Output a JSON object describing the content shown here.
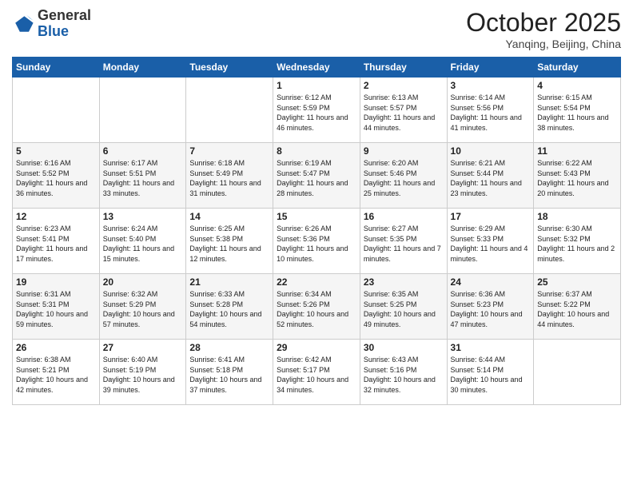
{
  "header": {
    "logo_general": "General",
    "logo_blue": "Blue",
    "month": "October 2025",
    "location": "Yanqing, Beijing, China"
  },
  "days_of_week": [
    "Sunday",
    "Monday",
    "Tuesday",
    "Wednesday",
    "Thursday",
    "Friday",
    "Saturday"
  ],
  "weeks": [
    [
      {
        "day": "",
        "info": ""
      },
      {
        "day": "",
        "info": ""
      },
      {
        "day": "",
        "info": ""
      },
      {
        "day": "1",
        "info": "Sunrise: 6:12 AM\nSunset: 5:59 PM\nDaylight: 11 hours and 46 minutes."
      },
      {
        "day": "2",
        "info": "Sunrise: 6:13 AM\nSunset: 5:57 PM\nDaylight: 11 hours and 44 minutes."
      },
      {
        "day": "3",
        "info": "Sunrise: 6:14 AM\nSunset: 5:56 PM\nDaylight: 11 hours and 41 minutes."
      },
      {
        "day": "4",
        "info": "Sunrise: 6:15 AM\nSunset: 5:54 PM\nDaylight: 11 hours and 38 minutes."
      }
    ],
    [
      {
        "day": "5",
        "info": "Sunrise: 6:16 AM\nSunset: 5:52 PM\nDaylight: 11 hours and 36 minutes."
      },
      {
        "day": "6",
        "info": "Sunrise: 6:17 AM\nSunset: 5:51 PM\nDaylight: 11 hours and 33 minutes."
      },
      {
        "day": "7",
        "info": "Sunrise: 6:18 AM\nSunset: 5:49 PM\nDaylight: 11 hours and 31 minutes."
      },
      {
        "day": "8",
        "info": "Sunrise: 6:19 AM\nSunset: 5:47 PM\nDaylight: 11 hours and 28 minutes."
      },
      {
        "day": "9",
        "info": "Sunrise: 6:20 AM\nSunset: 5:46 PM\nDaylight: 11 hours and 25 minutes."
      },
      {
        "day": "10",
        "info": "Sunrise: 6:21 AM\nSunset: 5:44 PM\nDaylight: 11 hours and 23 minutes."
      },
      {
        "day": "11",
        "info": "Sunrise: 6:22 AM\nSunset: 5:43 PM\nDaylight: 11 hours and 20 minutes."
      }
    ],
    [
      {
        "day": "12",
        "info": "Sunrise: 6:23 AM\nSunset: 5:41 PM\nDaylight: 11 hours and 17 minutes."
      },
      {
        "day": "13",
        "info": "Sunrise: 6:24 AM\nSunset: 5:40 PM\nDaylight: 11 hours and 15 minutes."
      },
      {
        "day": "14",
        "info": "Sunrise: 6:25 AM\nSunset: 5:38 PM\nDaylight: 11 hours and 12 minutes."
      },
      {
        "day": "15",
        "info": "Sunrise: 6:26 AM\nSunset: 5:36 PM\nDaylight: 11 hours and 10 minutes."
      },
      {
        "day": "16",
        "info": "Sunrise: 6:27 AM\nSunset: 5:35 PM\nDaylight: 11 hours and 7 minutes."
      },
      {
        "day": "17",
        "info": "Sunrise: 6:29 AM\nSunset: 5:33 PM\nDaylight: 11 hours and 4 minutes."
      },
      {
        "day": "18",
        "info": "Sunrise: 6:30 AM\nSunset: 5:32 PM\nDaylight: 11 hours and 2 minutes."
      }
    ],
    [
      {
        "day": "19",
        "info": "Sunrise: 6:31 AM\nSunset: 5:31 PM\nDaylight: 10 hours and 59 minutes."
      },
      {
        "day": "20",
        "info": "Sunrise: 6:32 AM\nSunset: 5:29 PM\nDaylight: 10 hours and 57 minutes."
      },
      {
        "day": "21",
        "info": "Sunrise: 6:33 AM\nSunset: 5:28 PM\nDaylight: 10 hours and 54 minutes."
      },
      {
        "day": "22",
        "info": "Sunrise: 6:34 AM\nSunset: 5:26 PM\nDaylight: 10 hours and 52 minutes."
      },
      {
        "day": "23",
        "info": "Sunrise: 6:35 AM\nSunset: 5:25 PM\nDaylight: 10 hours and 49 minutes."
      },
      {
        "day": "24",
        "info": "Sunrise: 6:36 AM\nSunset: 5:23 PM\nDaylight: 10 hours and 47 minutes."
      },
      {
        "day": "25",
        "info": "Sunrise: 6:37 AM\nSunset: 5:22 PM\nDaylight: 10 hours and 44 minutes."
      }
    ],
    [
      {
        "day": "26",
        "info": "Sunrise: 6:38 AM\nSunset: 5:21 PM\nDaylight: 10 hours and 42 minutes."
      },
      {
        "day": "27",
        "info": "Sunrise: 6:40 AM\nSunset: 5:19 PM\nDaylight: 10 hours and 39 minutes."
      },
      {
        "day": "28",
        "info": "Sunrise: 6:41 AM\nSunset: 5:18 PM\nDaylight: 10 hours and 37 minutes."
      },
      {
        "day": "29",
        "info": "Sunrise: 6:42 AM\nSunset: 5:17 PM\nDaylight: 10 hours and 34 minutes."
      },
      {
        "day": "30",
        "info": "Sunrise: 6:43 AM\nSunset: 5:16 PM\nDaylight: 10 hours and 32 minutes."
      },
      {
        "day": "31",
        "info": "Sunrise: 6:44 AM\nSunset: 5:14 PM\nDaylight: 10 hours and 30 minutes."
      },
      {
        "day": "",
        "info": ""
      }
    ]
  ]
}
